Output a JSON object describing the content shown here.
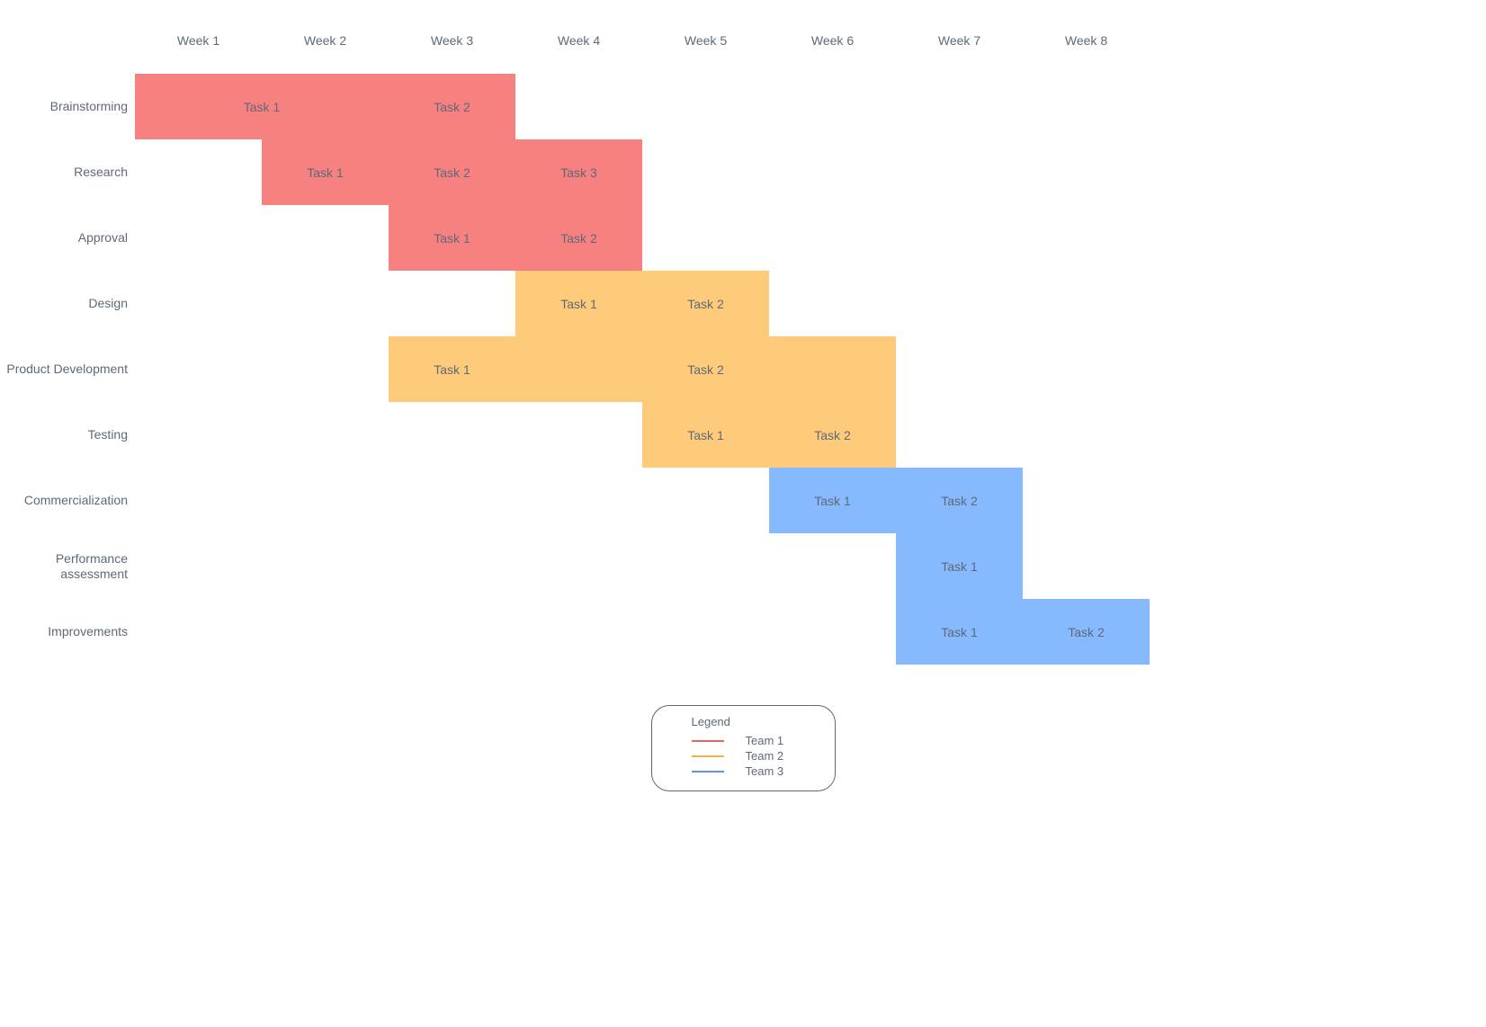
{
  "chart_data": {
    "type": "bar",
    "title": "",
    "xlabel": "",
    "ylabel": "",
    "x_categories": [
      "Week 1",
      "Week 2",
      "Week 3",
      "Week 4",
      "Week 5",
      "Week 6",
      "Week  7",
      "Week 8"
    ],
    "y_categories": [
      "Brainstorming",
      "Research",
      "Approval",
      "Design",
      "Product Development",
      "Testing",
      "Commercialization",
      "Performance assessment",
      "Improvements"
    ],
    "series": [
      {
        "name": "Team 1",
        "color": "#f78181"
      },
      {
        "name": "Team 2",
        "color": "#fecb7a"
      },
      {
        "name": "Team 3",
        "color": "#87b9ff"
      }
    ],
    "rows": [
      {
        "label": "Brainstorming",
        "tasks": [
          {
            "label": "Task 1",
            "start": 1,
            "duration": 2,
            "team": "Team 1"
          },
          {
            "label": "Task 2",
            "start": 3,
            "duration": 1,
            "team": "Team 1"
          }
        ]
      },
      {
        "label": "Research",
        "tasks": [
          {
            "label": "Task 1",
            "start": 2,
            "duration": 1,
            "team": "Team 1"
          },
          {
            "label": "Task 2",
            "start": 3,
            "duration": 1,
            "team": "Team 1"
          },
          {
            "label": "Task 3",
            "start": 4,
            "duration": 1,
            "team": "Team 1"
          }
        ]
      },
      {
        "label": "Approval",
        "tasks": [
          {
            "label": "Task 1",
            "start": 3,
            "duration": 1,
            "team": "Team 1"
          },
          {
            "label": "Task 2",
            "start": 4,
            "duration": 1,
            "team": "Team 1"
          }
        ]
      },
      {
        "label": "Design",
        "tasks": [
          {
            "label": "Task 1",
            "start": 4,
            "duration": 1,
            "team": "Team 2"
          },
          {
            "label": "Task 2",
            "start": 5,
            "duration": 1,
            "team": "Team 2"
          }
        ]
      },
      {
        "label": "Product Development",
        "tasks": [
          {
            "label": "Task 1",
            "start": 3,
            "duration": 1,
            "team": "Team 2"
          },
          {
            "label": "Task 2",
            "start": 4,
            "duration": 3,
            "team": "Team 2"
          }
        ]
      },
      {
        "label": "Testing",
        "tasks": [
          {
            "label": "Task 1",
            "start": 5,
            "duration": 1,
            "team": "Team 2"
          },
          {
            "label": "Task 2",
            "start": 6,
            "duration": 1,
            "team": "Team 2"
          }
        ]
      },
      {
        "label": "Commercialization",
        "tasks": [
          {
            "label": "Task 1",
            "start": 6,
            "duration": 1,
            "team": "Team 3"
          },
          {
            "label": "Task 2",
            "start": 7,
            "duration": 1,
            "team": "Team 3"
          }
        ]
      },
      {
        "label": "Performance assessment",
        "tasks": [
          {
            "label": "Task 1",
            "start": 7,
            "duration": 1,
            "team": "Team 3"
          }
        ]
      },
      {
        "label": "Improvements",
        "tasks": [
          {
            "label": "Task 1",
            "start": 7,
            "duration": 1,
            "team": "Team 3"
          },
          {
            "label": "Task 2",
            "start": 8,
            "duration": 1,
            "team": "Team 3"
          }
        ]
      }
    ],
    "legend": {
      "title": "Legend",
      "items": [
        {
          "label": "Team 1",
          "color": "#ec6161"
        },
        {
          "label": "Team 2",
          "color": "#f3b14d"
        },
        {
          "label": "Team 3",
          "color": "#5b95e6"
        }
      ]
    }
  }
}
